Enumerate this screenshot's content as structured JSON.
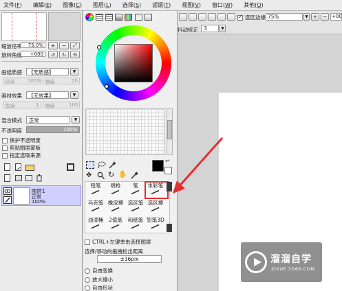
{
  "menubar": {
    "items": [
      {
        "label": "文件",
        "key": "F"
      },
      {
        "label": "编辑",
        "key": "E"
      },
      {
        "label": "图像",
        "key": "C"
      },
      {
        "label": "图层",
        "key": "L"
      },
      {
        "label": "选择",
        "key": "S"
      },
      {
        "label": "滤镜",
        "key": "T"
      },
      {
        "label": "视图",
        "key": "V"
      },
      {
        "label": "窗口",
        "key": "W"
      },
      {
        "label": "其他",
        "key": "O"
      }
    ]
  },
  "navigator": {
    "zoom_label": "缩放倍率",
    "zoom_value": "75.0%",
    "rotate_label": "旋转角度",
    "rotate_value": "+000"
  },
  "layer_props": {
    "paper_texture_label": "画纸质感",
    "paper_texture_value": "【无质感】",
    "texture_scale_label": "倍率",
    "texture_scale_value": "100%",
    "texture_strength_label": "强度",
    "texture_strength_value": "20",
    "paper_effect_label": "画材效果",
    "paper_effect_value": "【无效果】",
    "effect_width_label": "宽度",
    "effect_width_value": "1",
    "effect_strength_label": "强度",
    "effect_strength_value": "100",
    "blend_mode_label": "混合模式",
    "blend_mode_value": "正常",
    "opacity_label": "不透明度",
    "opacity_value": "100%",
    "checkbox_preserve_opacity": "保护不透明度",
    "checkbox_clipping": "剪贴图层蒙板",
    "checkbox_selection_source": "指定选取来源"
  },
  "layer": {
    "name": "图层1",
    "mode": "正常",
    "opacity": "100%"
  },
  "tools": {
    "cells": [
      {
        "name": "铅笔",
        "id": "pencil"
      },
      {
        "name": "喷枪",
        "id": "airbrush"
      },
      {
        "name": "笔",
        "id": "pen"
      },
      {
        "name": "水彩笔",
        "id": "watercolor"
      },
      {
        "name": "马克笔",
        "id": "marker"
      },
      {
        "name": "橡皮擦",
        "id": "eraser"
      },
      {
        "name": "选区笔",
        "id": "select-pen"
      },
      {
        "name": "选区擦",
        "id": "select-eraser"
      },
      {
        "name": "油漆桶",
        "id": "bucket"
      },
      {
        "name": "2值笔",
        "id": "binary-pen"
      },
      {
        "name": "和纸笔",
        "id": "washi-pen"
      },
      {
        "name": "铅笔3D",
        "id": "pencil-3d"
      }
    ],
    "ctrl_option": "CTRL+左键单击选择图层",
    "drag_label": "选择/移动的拖拽检出距离",
    "drag_value": "±16pix",
    "transform_options": [
      "自由变换",
      "放大缩小",
      "自由形状"
    ]
  },
  "canvas_toolbar": {
    "antialias_label": "选区边缘",
    "zoom_value": "75%",
    "angle_value": "+000",
    "stabilizer_label": "抖动修正",
    "stabilizer_value": "3"
  },
  "watermark": {
    "title": "溜溜自学",
    "url": "ZIXUE.3D66.COM"
  },
  "colors": {
    "highlight_red": "#e03030",
    "layer_selected": "#cfd0ff",
    "watermark_bg": "#7a7a7a"
  }
}
